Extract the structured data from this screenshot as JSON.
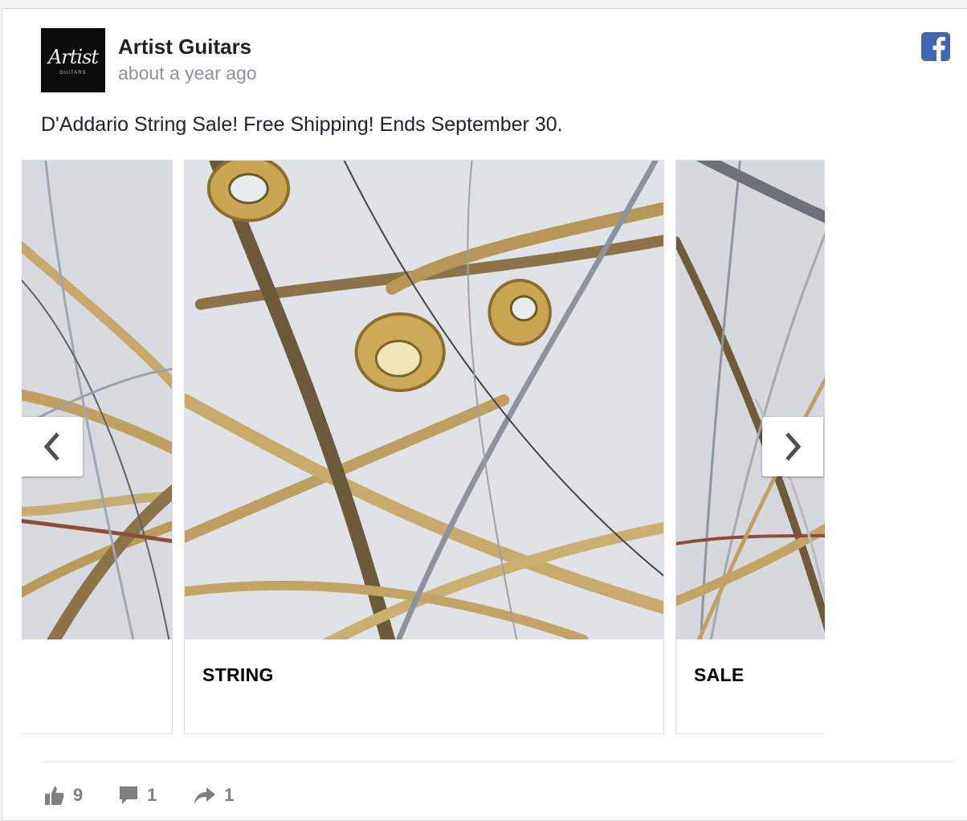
{
  "post": {
    "page_name": "Artist Guitars",
    "time": "about a year ago",
    "text": "D'Addario String Sale! Free Shipping! Ends September 30.",
    "avatar": {
      "logo_script": "Artist",
      "logo_small": "GUITARS"
    },
    "platform_icon": "facebook-icon"
  },
  "carousel": {
    "slides": [
      {
        "caption": ""
      },
      {
        "caption": "STRING"
      },
      {
        "caption": "SALE"
      }
    ],
    "prev_icon": "chevron-left-icon",
    "next_icon": "chevron-right-icon"
  },
  "actions": {
    "likes": "9",
    "comments": "1",
    "shares": "1"
  },
  "colors": {
    "brand_blue": "#4267b2",
    "text_dark": "#1d2129",
    "text_muted": "#90949c",
    "action_gray": "#7f7f7f"
  }
}
